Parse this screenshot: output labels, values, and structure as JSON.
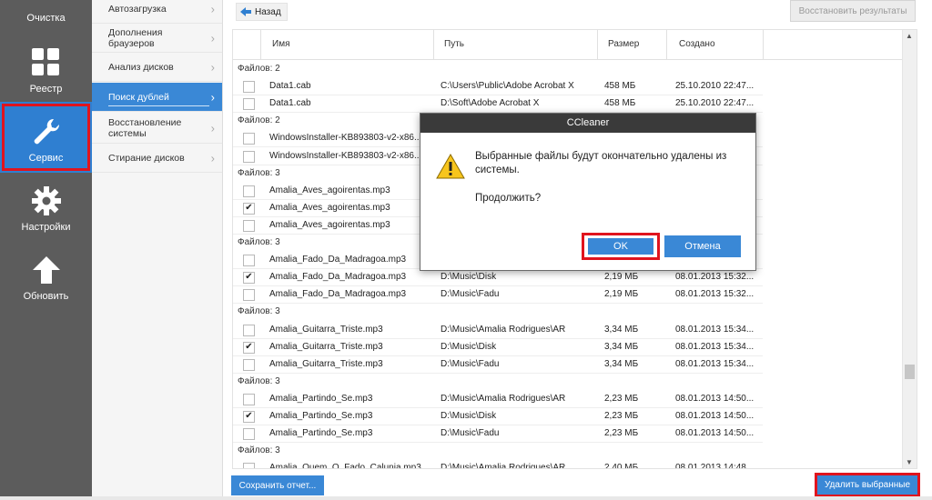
{
  "nav": {
    "items": [
      {
        "label": "Очистка",
        "icon": "broom-icon"
      },
      {
        "label": "Реестр",
        "icon": "grid-icon"
      },
      {
        "label": "Сервис",
        "icon": "wrench-icon"
      },
      {
        "label": "Настройки",
        "icon": "gear-icon"
      },
      {
        "label": "Обновить",
        "icon": "arrow-up-icon"
      }
    ]
  },
  "submenu": {
    "items": [
      {
        "label": "Автозагрузка"
      },
      {
        "label": "Дополнения браузеров"
      },
      {
        "label": "Анализ дисков"
      },
      {
        "label": "Поиск дублей"
      },
      {
        "label": "Восстановление системы"
      },
      {
        "label": "Стирание дисков"
      }
    ]
  },
  "topbar": {
    "back_label": "Назад",
    "restore_label": "Восстановить результаты"
  },
  "table": {
    "headers": {
      "name": "Имя",
      "path": "Путь",
      "size": "Размер",
      "created": "Создано"
    },
    "rows": [
      {
        "group": "Файлов: 2"
      },
      {
        "name": "Data1.cab",
        "path": "C:\\Users\\Public\\Adobe Acrobat X",
        "size": "458 МБ",
        "date": "25.10.2010 22:47...",
        "checked": false
      },
      {
        "name": "Data1.cab",
        "path": "D:\\Soft\\Adobe Acrobat X",
        "size": "458 МБ",
        "date": "25.10.2010 22:47...",
        "checked": false
      },
      {
        "group": "Файлов: 2"
      },
      {
        "name": "WindowsInstaller-KB893803-v2-x86....",
        "path": "",
        "size": "",
        "date": "",
        "checked": false
      },
      {
        "name": "WindowsInstaller-KB893803-v2-x86....",
        "path": "",
        "size": "",
        "date": "",
        "checked": false
      },
      {
        "group": "Файлов: 3"
      },
      {
        "name": "Amalia_Aves_agoirentas.mp3",
        "path": "",
        "size": "",
        "date": "",
        "checked": false
      },
      {
        "name": "Amalia_Aves_agoirentas.mp3",
        "path": "",
        "size": "",
        "date": "",
        "checked": true
      },
      {
        "name": "Amalia_Aves_agoirentas.mp3",
        "path": "",
        "size": "",
        "date": "",
        "checked": false
      },
      {
        "group": "Файлов: 3"
      },
      {
        "name": "Amalia_Fado_Da_Madragoa.mp3",
        "path": "",
        "size": "",
        "date": "",
        "checked": false
      },
      {
        "name": "Amalia_Fado_Da_Madragoa.mp3",
        "path": "D:\\Music\\Disk",
        "size": "2,19 МБ",
        "date": "08.01.2013 15:32...",
        "checked": true
      },
      {
        "name": "Amalia_Fado_Da_Madragoa.mp3",
        "path": "D:\\Music\\Fadu",
        "size": "2,19 МБ",
        "date": "08.01.2013 15:32...",
        "checked": false
      },
      {
        "group": "Файлов: 3"
      },
      {
        "name": "Amalia_Guitarra_Triste.mp3",
        "path": "D:\\Music\\Amalia Rodrigues\\AR",
        "size": "3,34 МБ",
        "date": "08.01.2013 15:34...",
        "checked": false
      },
      {
        "name": "Amalia_Guitarra_Triste.mp3",
        "path": "D:\\Music\\Disk",
        "size": "3,34 МБ",
        "date": "08.01.2013 15:34...",
        "checked": true
      },
      {
        "name": "Amalia_Guitarra_Triste.mp3",
        "path": "D:\\Music\\Fadu",
        "size": "3,34 МБ",
        "date": "08.01.2013 15:34...",
        "checked": false
      },
      {
        "group": "Файлов: 3"
      },
      {
        "name": "Amalia_Partindo_Se.mp3",
        "path": "D:\\Music\\Amalia Rodrigues\\AR",
        "size": "2,23 МБ",
        "date": "08.01.2013 14:50...",
        "checked": false
      },
      {
        "name": "Amalia_Partindo_Se.mp3",
        "path": "D:\\Music\\Disk",
        "size": "2,23 МБ",
        "date": "08.01.2013 14:50...",
        "checked": true
      },
      {
        "name": "Amalia_Partindo_Se.mp3",
        "path": "D:\\Music\\Fadu",
        "size": "2,23 МБ",
        "date": "08.01.2013 14:50...",
        "checked": false
      },
      {
        "group": "Файлов: 3"
      },
      {
        "name": "Amalia_Quem_O_Fado_Calunia.mp3",
        "path": "D:\\Music\\Amalia Rodrigues\\AR",
        "size": "2,40 МБ",
        "date": "08.01.2013 14:48...",
        "checked": false
      }
    ]
  },
  "bottom": {
    "save_label": "Сохранить отчет...",
    "delete_label": "Удалить выбранные"
  },
  "dialog": {
    "title": "CCleaner",
    "message": "Выбранные файлы будут окончательно удалены из системы.",
    "question": "Продолжить?",
    "ok_label": "OK",
    "cancel_label": "Отмена"
  },
  "colors": {
    "accent": "#3a88d6",
    "nav_bg": "#5c5c5c",
    "highlight": "#e0141e",
    "dialog_title": "#3a3a3a"
  }
}
